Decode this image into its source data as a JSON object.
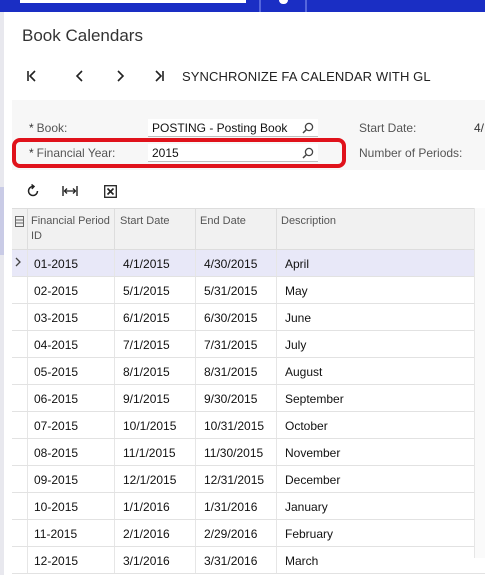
{
  "header": {
    "page_title": "Book Calendars",
    "sync_button": "SYNCHRONIZE FA CALENDAR WITH GL"
  },
  "form": {
    "book_label": "Book:",
    "book_value": "POSTING - Posting Book",
    "financial_year_label": "Financial Year:",
    "financial_year_value": "2015",
    "start_date_label": "Start Date:",
    "start_date_value": "4/",
    "number_of_periods_label": "Number of Periods:",
    "required_mark": "*"
  },
  "grid": {
    "columns": [
      "Financial Period ID",
      "Start Date",
      "End Date",
      "Description"
    ],
    "rows": [
      {
        "period": "01-2015",
        "start": "4/1/2015",
        "end": "4/30/2015",
        "description": "April"
      },
      {
        "period": "02-2015",
        "start": "5/1/2015",
        "end": "5/31/2015",
        "description": "May"
      },
      {
        "period": "03-2015",
        "start": "6/1/2015",
        "end": "6/30/2015",
        "description": "June"
      },
      {
        "period": "04-2015",
        "start": "7/1/2015",
        "end": "7/31/2015",
        "description": "July"
      },
      {
        "period": "05-2015",
        "start": "8/1/2015",
        "end": "8/31/2015",
        "description": "August"
      },
      {
        "period": "06-2015",
        "start": "9/1/2015",
        "end": "9/30/2015",
        "description": "September"
      },
      {
        "period": "07-2015",
        "start": "10/1/2015",
        "end": "10/31/2015",
        "description": "October"
      },
      {
        "period": "08-2015",
        "start": "11/1/2015",
        "end": "11/30/2015",
        "description": "November"
      },
      {
        "period": "09-2015",
        "start": "12/1/2015",
        "end": "12/31/2015",
        "description": "December"
      },
      {
        "period": "10-2015",
        "start": "1/1/2016",
        "end": "1/31/2016",
        "description": "January"
      },
      {
        "period": "11-2015",
        "start": "2/1/2016",
        "end": "2/29/2016",
        "description": "February"
      },
      {
        "period": "12-2015",
        "start": "3/1/2016",
        "end": "3/31/2016",
        "description": "March"
      }
    ]
  },
  "colors": {
    "topbar": "#1a2ec4",
    "highlight": "#e0121b",
    "active_row": "#e8e8f8"
  },
  "icons": [
    "first-page-icon",
    "previous-icon",
    "next-icon",
    "last-page-icon",
    "search-icon",
    "refresh-icon",
    "fit-columns-icon",
    "export-excel-icon",
    "column-config-icon",
    "row-pointer-icon"
  ]
}
